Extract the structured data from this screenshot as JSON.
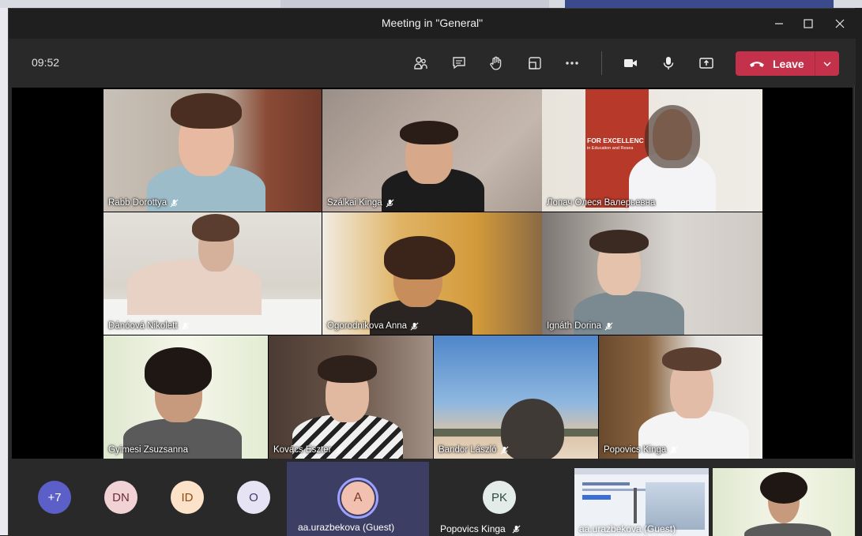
{
  "window": {
    "title": "Meeting in \"General\""
  },
  "toolbar": {
    "clock": "09:52",
    "leave_label": "Leave",
    "icons": [
      "people-icon",
      "chat-icon",
      "raise-hand-icon",
      "breakout-rooms-icon",
      "more-options-icon",
      "camera-icon",
      "microphone-icon",
      "share-screen-icon"
    ]
  },
  "tiles": [
    {
      "name": "Rabb Dorottya"
    },
    {
      "name": "Szálkai Kinga"
    },
    {
      "name": "Лопач Олеся Валерьевна"
    },
    {
      "name": "Dánóová Nikolett"
    },
    {
      "name": "Ogorodnikova Anna"
    },
    {
      "name": "Ignáth Dorina"
    },
    {
      "name": "Gyimesi Zsuzsanna"
    },
    {
      "name": "Kovács Eszter"
    },
    {
      "name": "Bandor László"
    },
    {
      "name": "Popovics Kinga"
    }
  ],
  "poster": {
    "line1": "FOR EXCELLENC",
    "line2": "in Education and Resea"
  },
  "strip": {
    "overflow": "+7",
    "avatars": [
      "DN",
      "ID",
      "O"
    ],
    "guest_initial": "A",
    "guest_name": "aa.urazbekova (Guest)",
    "pk_initial": "PK",
    "pk_name": "Popovics Kinga",
    "share_overlay_name": "aa.urazbekova (Guest)"
  },
  "colors": {
    "leave": "#c4314b",
    "overflow_avatar": "#5b5fc7",
    "guest_tile": "#3c3e63"
  }
}
